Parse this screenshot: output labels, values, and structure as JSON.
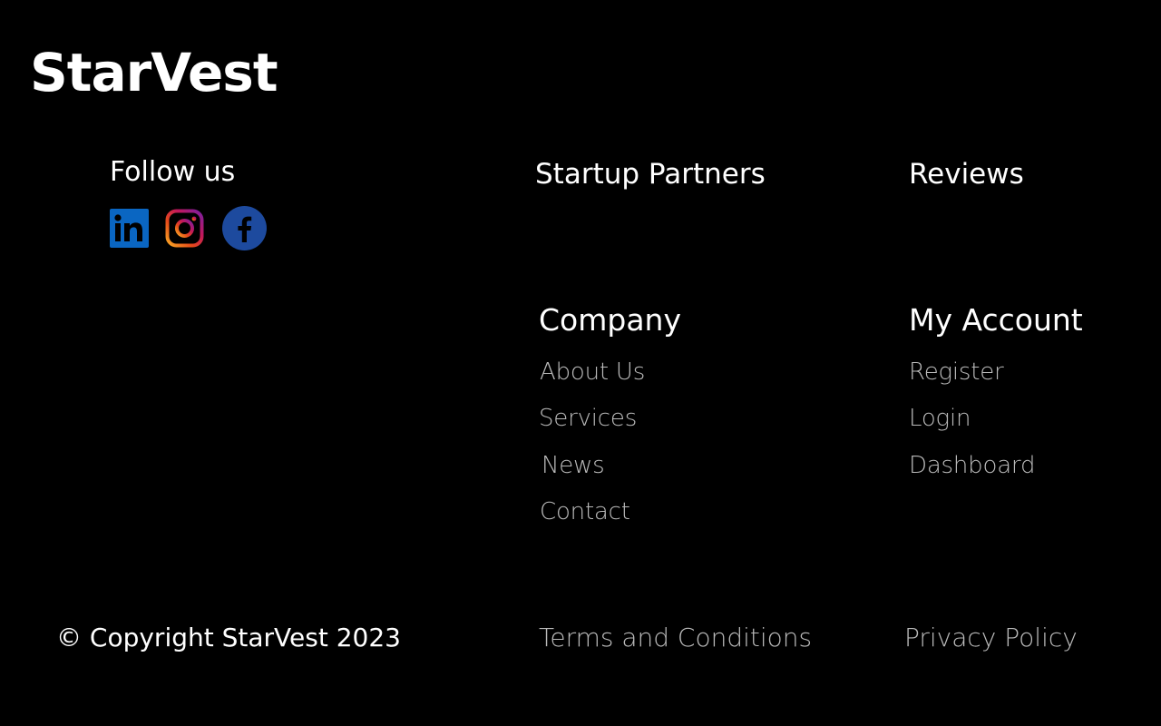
{
  "brand": {
    "name": "StarVest"
  },
  "follow": {
    "heading": "Follow us",
    "icons": [
      "linkedin-icon",
      "instagram-icon",
      "facebook-icon"
    ]
  },
  "sections": {
    "startup_partners": "Startup Partners",
    "reviews": "Reviews",
    "company": {
      "heading": "Company",
      "links": [
        "About Us",
        "Services",
        "News",
        "Contact"
      ]
    },
    "my_account": {
      "heading": "My Account",
      "links": [
        "Register",
        "Login",
        "Dashboard"
      ]
    }
  },
  "footer": {
    "copyright": "© Copyright StarVest 2023",
    "terms": "Terms and Conditions",
    "privacy": "Privacy Policy"
  },
  "colors": {
    "background": "#000000",
    "text": "#ffffff",
    "link": "#cfcfcf",
    "linkedin": "#0a66c2",
    "facebook": "#1d4a9e"
  }
}
